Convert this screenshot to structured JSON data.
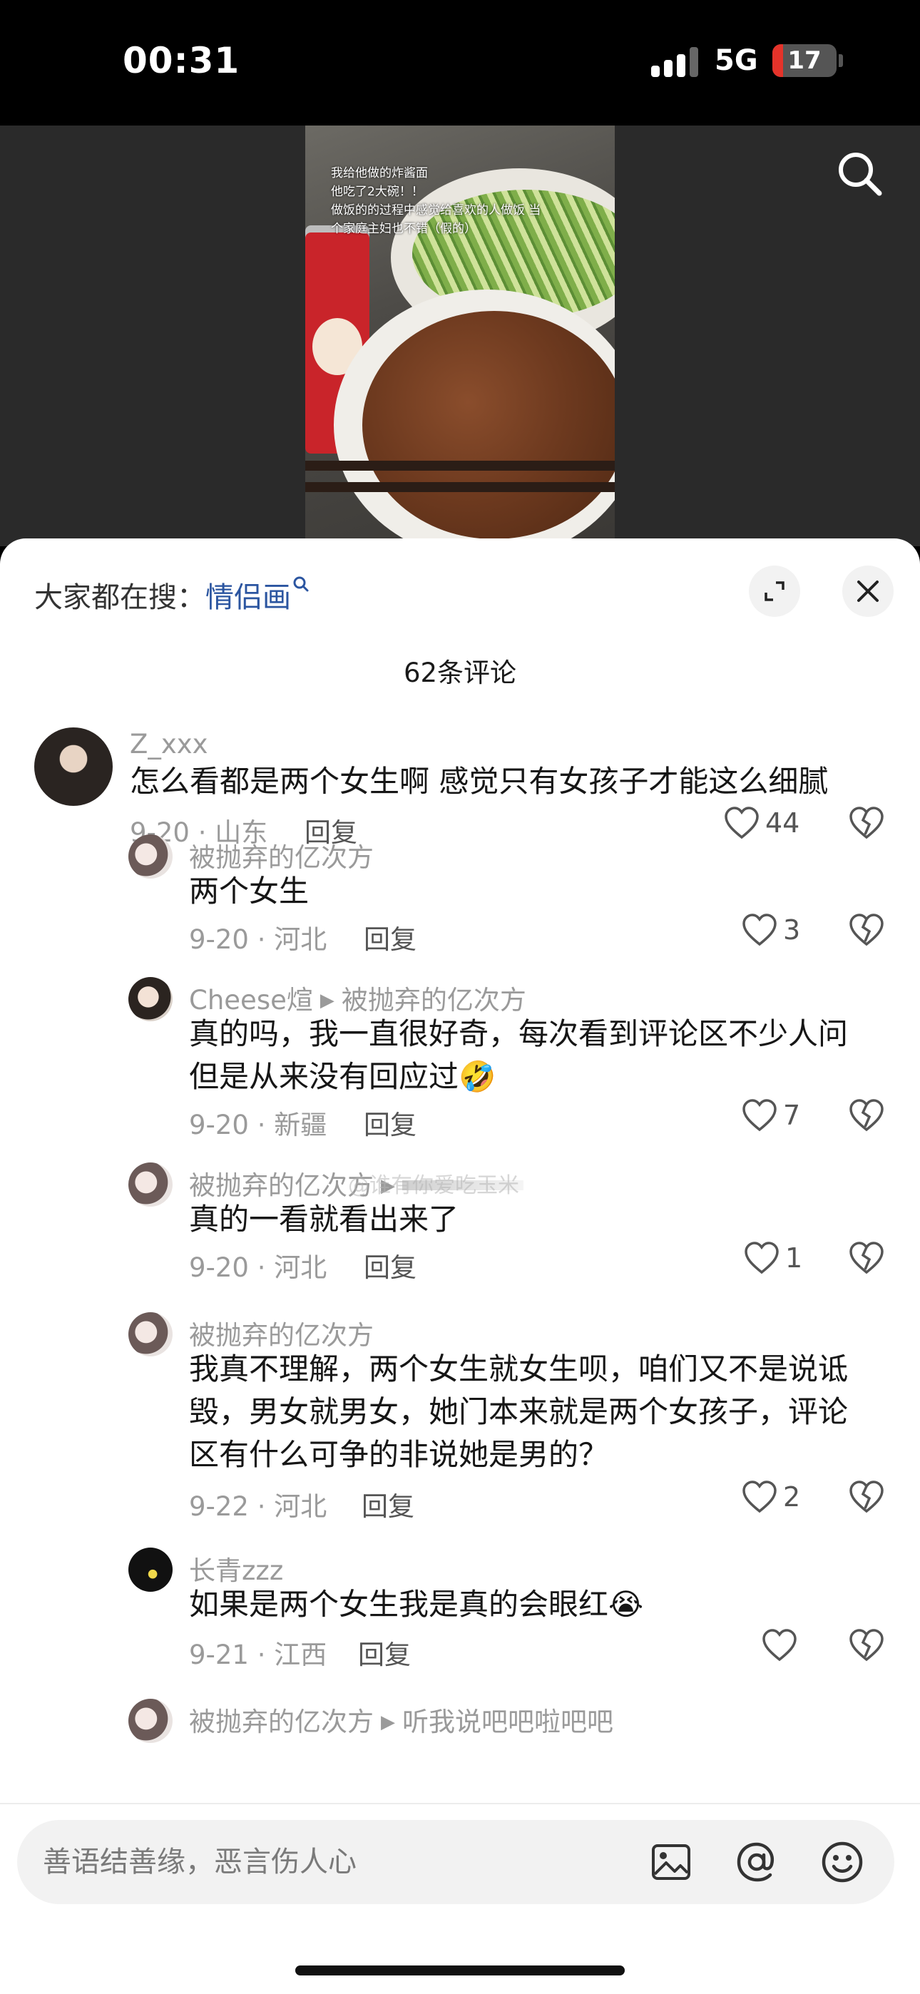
{
  "status_bar": {
    "time": "00:31",
    "network": "5G",
    "battery": "17",
    "battery_level": 0.17
  },
  "video": {
    "caption": "我给他做的炸酱面\n他吃了2大碗！！\n做饭的的过程中感觉给喜欢的人做饭 当个家庭主妇也不错（假的）"
  },
  "sheet": {
    "hot_search_prefix": "大家都在搜：",
    "hot_search_keyword": "情侣画",
    "comment_count": "62条评论"
  },
  "comments": [
    {
      "user": "Z_xxx",
      "text": "怎么看都是两个女生啊 感觉只有女孩子才能这么细腻",
      "meta": "9-20 · 山东",
      "reply": "回复",
      "likes": "44"
    },
    {
      "user": "被抛弃的亿次方",
      "text": "两个女生",
      "meta": "9-20 · 河北",
      "reply": "回复",
      "likes": "3"
    },
    {
      "user": "Cheese煊",
      "reply_to": "被抛弃的亿次方",
      "text": "真的吗，我一直很好奇，每次看到评论区不少人问但是从来没有回应过🤣",
      "meta": "9-20 · 新疆",
      "reply": "回复",
      "likes": "7"
    },
    {
      "user": "被抛弃的亿次方",
      "reply_to": "",
      "text": "真的一看就看出来了",
      "meta": "9-20 · 河北",
      "reply": "回复",
      "likes": "1"
    },
    {
      "user": "被抛弃的亿次方",
      "text": "我真不理解，两个女生就女生呗，咱们又不是说诋毁，男女就男女，她门本来就是两个女孩子，评论区有什么可争的非说她是男的？",
      "meta": "9-22 · 河北",
      "reply": "回复",
      "likes": "2"
    },
    {
      "user": "长青zzz",
      "text": "如果是两个女生我是真的会眼红😭",
      "meta": "9-21 · 江西",
      "reply": "回复",
      "likes": ""
    },
    {
      "user": "被抛弃的亿次方",
      "reply_to": "听我说吧吧啦吧吧"
    }
  ],
  "watermark": "@谁有你爱吃玉米",
  "input": {
    "placeholder": "善语结善缘，恶言伤人心"
  },
  "icons": {
    "search": "search-icon",
    "expand": "expand-icon",
    "close": "close-icon",
    "like": "heart-icon",
    "dislike": "broken-heart-icon",
    "image": "image-icon",
    "at": "at-icon",
    "emoji": "emoji-icon"
  },
  "colors": {
    "keyword": "#2b55a0",
    "battery_low": "#e5332a",
    "meta_gray": "#9a9a9a"
  }
}
